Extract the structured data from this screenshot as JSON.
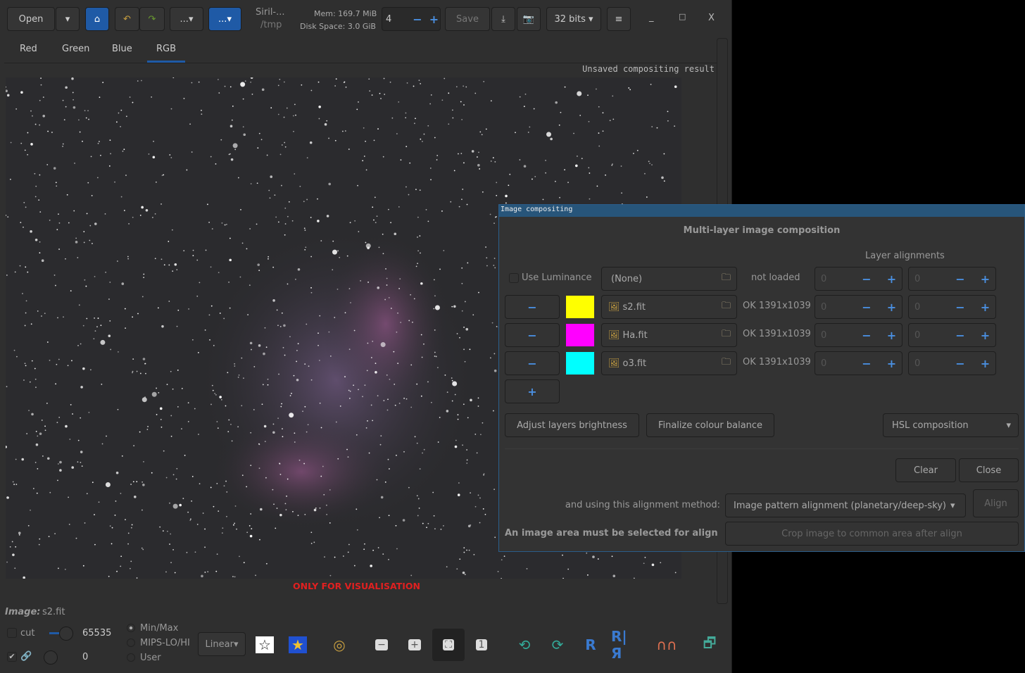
{
  "toolbar": {
    "open": "Open",
    "more1": "...",
    "more2": "...",
    "title": "Siril-...",
    "path": "/tmp",
    "mem": "Mem: 169.7 MiB",
    "disk": "Disk Space: 3.0 GiB",
    "threads": "4",
    "save": "Save",
    "bits": "32 bits",
    "minimize": "_",
    "maximize": "□",
    "close": "X"
  },
  "tabs": [
    "Red",
    "Green",
    "Blue",
    "RGB"
  ],
  "active_tab": "RGB",
  "canvas": {
    "status": "Unsaved compositing result",
    "warning": "ONLY FOR VISUALISATION"
  },
  "image_label": "Image:",
  "image_name": "s2.fit",
  "bottom": {
    "cut": "cut",
    "high": "65535",
    "low": "0",
    "radio": [
      "Min/Max",
      "MIPS-LO/HI",
      "User"
    ],
    "selected_radio": "Min/Max",
    "scale": "Linear"
  },
  "dialog": {
    "title": "Image compositing",
    "heading": "Multi-layer image composition",
    "layer_alignments": "Layer alignments",
    "use_luminance": "Use Luminance",
    "lum_file": "(None)",
    "lum_status": "not loaded",
    "layers": [
      {
        "file": "s2.fit",
        "status": "OK 1391x1039",
        "color": "#ffff00",
        "x": "0",
        "y": "0"
      },
      {
        "file": "Ha.fit",
        "status": "OK 1391x1039",
        "color": "#ff00ff",
        "x": "0",
        "y": "0"
      },
      {
        "file": "o3.fit",
        "status": "OK 1391x1039",
        "color": "#00ffff",
        "x": "0",
        "y": "0"
      }
    ],
    "lum_x": "0",
    "lum_y": "0",
    "adjust": "Adjust layers brightness",
    "finalize": "Finalize colour balance",
    "composition": "HSL composition",
    "clear": "Clear",
    "close": "Close",
    "align_method_label": "and using this alignment method:",
    "align_method": "Image pattern alignment (planetary/deep-sky)",
    "align": "Align",
    "area_msg": "An image area must be selected for align",
    "crop": "Crop image to common area after align"
  },
  "colors": {
    "accent": "#1f5aa6",
    "warning": "#e02020",
    "dialog_title": "#27557a"
  }
}
